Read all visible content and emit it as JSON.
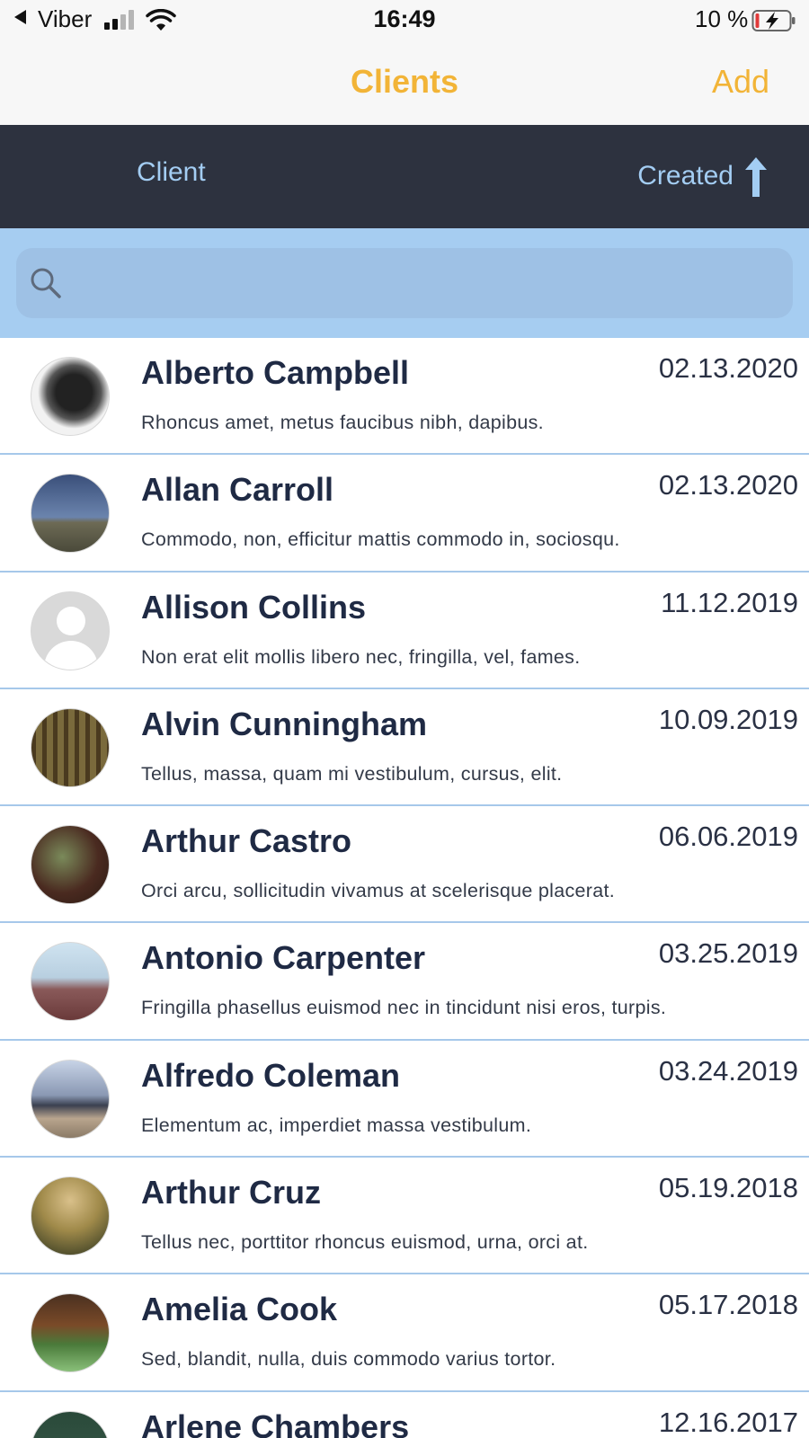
{
  "status_bar": {
    "carrier": "Viber",
    "time": "16:49",
    "battery": "10 %"
  },
  "nav": {
    "title": "Clients",
    "add_label": "Add"
  },
  "sort_bar": {
    "client_label": "Client",
    "created_label": "Created",
    "sort_direction": "ascending"
  },
  "search": {
    "placeholder": ""
  },
  "clients": [
    {
      "name": "Alberto Campbell",
      "date": "02.13.2020",
      "description": "Rhoncus amet, metus faucibus nibh, dapibus.",
      "avatar": "feet-photo"
    },
    {
      "name": "Allan Carroll",
      "date": "02.13.2020",
      "description": "Commodo, non, efficitur mattis commodo in, sociosqu.",
      "avatar": "road-sky-photo"
    },
    {
      "name": "Allison Collins",
      "date": "11.12.2019",
      "description": "Non erat elit mollis libero nec, fringilla, vel, fames.",
      "avatar": "placeholder-person"
    },
    {
      "name": "Alvin Cunningham",
      "date": "10.09.2019",
      "description": "Tellus, massa, quam mi vestibulum, cursus, elit.",
      "avatar": "forest-photo"
    },
    {
      "name": "Arthur Castro",
      "date": "06.06.2019",
      "description": "Orci arcu, sollicitudin vivamus at scelerisque placerat.",
      "avatar": "mossy-log-photo"
    },
    {
      "name": "Antonio Carpenter",
      "date": "03.25.2019",
      "description": "Fringilla phasellus euismod nec in tincidunt nisi eros, turpis.",
      "avatar": "desert-person-photo"
    },
    {
      "name": "Alfredo Coleman",
      "date": "03.24.2019",
      "description": "Elementum ac, imperdiet massa vestibulum.",
      "avatar": "city-skyline-photo"
    },
    {
      "name": "Arthur Cruz",
      "date": "05.19.2018",
      "description": "Tellus nec, porttitor rhoncus euismod, urna, orci at.",
      "avatar": "cactus-photo"
    },
    {
      "name": "Amelia Cook",
      "date": "05.17.2018",
      "description": "Sed, blandit, nulla, duis commodo varius tortor.",
      "avatar": "dog-grass-photo"
    },
    {
      "name": "Arlene Chambers",
      "date": "12.16.2017",
      "description": "",
      "avatar": "landscape-photo"
    }
  ],
  "colors": {
    "accent": "#f2b437",
    "sort_bar_bg": "#2d323f",
    "sort_bar_text": "#a3cdf3",
    "search_band": "#a6cdf1",
    "divider": "#a6c8ea",
    "name_text": "#1f2a44"
  }
}
